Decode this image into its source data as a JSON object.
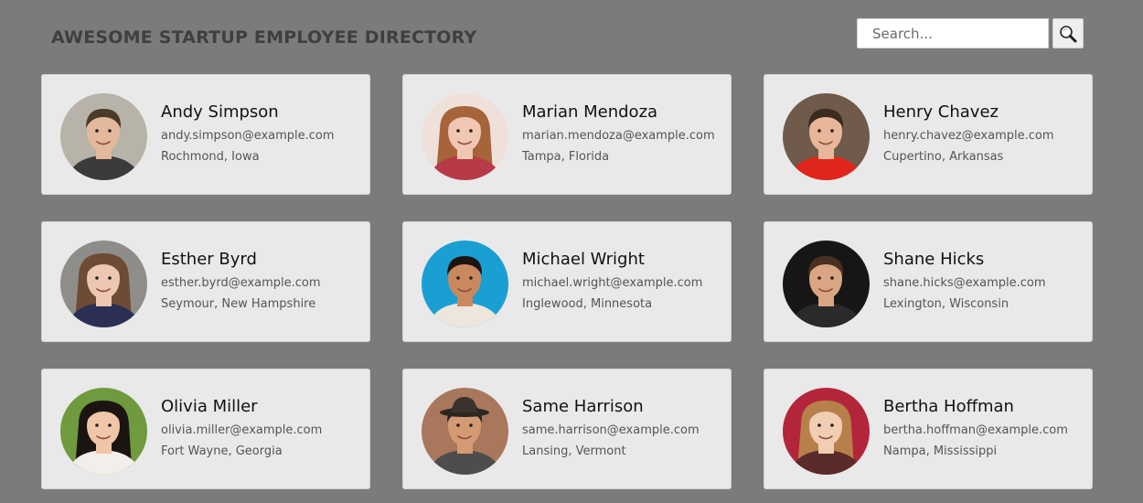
{
  "header": {
    "title": "AWESOME STARTUP EMPLOYEE DIRECTORY",
    "search_placeholder": "Search...",
    "search_icon": "magnifier-icon"
  },
  "employees": [
    {
      "name": "Andy Simpson",
      "email": "andy.simpson@example.com",
      "location": "Rochmond, Iowa",
      "avatar": {
        "bg": "#b8b3a8",
        "skin": "#e3b99e",
        "hair": "#4a3a2a",
        "shirt": "#3b3b3b"
      }
    },
    {
      "name": "Marian Mendoza",
      "email": "marian.mendoza@example.com",
      "location": "Tampa, Florida",
      "avatar": {
        "bg": "#efe0da",
        "skin": "#f0c7b3",
        "hair": "#a7643a",
        "shirt": "#b63a47"
      }
    },
    {
      "name": "Henry Chavez",
      "email": "henry.chavez@example.com",
      "location": "Cupertino, Arkansas",
      "avatar": {
        "bg": "#6f5a4c",
        "skin": "#e8b79a",
        "hair": "#3b2a20",
        "shirt": "#e0261b"
      }
    },
    {
      "name": "Esther Byrd",
      "email": "esther.byrd@example.com",
      "location": "Seymour, New Hampshire",
      "avatar": {
        "bg": "#8e8d8a",
        "skin": "#edc7b4",
        "hair": "#6e4b33",
        "shirt": "#2b2f56"
      }
    },
    {
      "name": "Michael Wright",
      "email": "michael.wright@example.com",
      "location": "Inglewood, Minnesota",
      "avatar": {
        "bg": "#1a9fd2",
        "skin": "#c9895f",
        "hair": "#1e1410",
        "shirt": "#ece6dc"
      }
    },
    {
      "name": "Shane Hicks",
      "email": "shane.hicks@example.com",
      "location": "Lexington, Wisconsin",
      "avatar": {
        "bg": "#161616",
        "skin": "#d9a583",
        "hair": "#4a3020",
        "shirt": "#2a2a2a"
      }
    },
    {
      "name": "Olivia Miller",
      "email": "olivia.miller@example.com",
      "location": "Fort Wayne, Georgia",
      "avatar": {
        "bg": "#6f9a3e",
        "skin": "#efc6a8",
        "hair": "#1c1410",
        "shirt": "#f2eeea"
      }
    },
    {
      "name": "Same Harrison",
      "email": "same.harrison@example.com",
      "location": "Lansing, Vermont",
      "avatar": {
        "bg": "#a8775c",
        "skin": "#d39a74",
        "hair": "#2a2020",
        "shirt": "#4d4d4d"
      }
    },
    {
      "name": "Bertha Hoffman",
      "email": "bertha.hoffman@example.com",
      "location": "Nampa, Mississippi",
      "avatar": {
        "bg": "#b3253b",
        "skin": "#f1cdb4",
        "hair": "#b7804a",
        "shirt": "#5b2a2a"
      }
    }
  ]
}
